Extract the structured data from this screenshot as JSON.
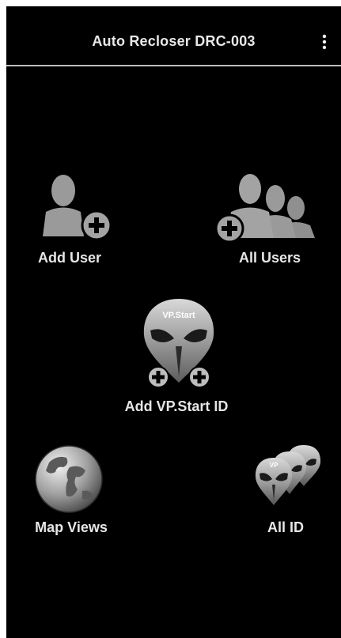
{
  "appbar": {
    "title": "Auto Recloser DRC-003",
    "menu_icon": "overflow-menu-icon"
  },
  "tiles": {
    "add_user": {
      "label": "Add User",
      "icon": "add-user-icon"
    },
    "all_users": {
      "label": "All Users",
      "icon": "users-group-icon"
    },
    "add_vpstart": {
      "label": "Add VP.Start ID",
      "icon": "alien-mask-add-icon",
      "badge_text": "VP.Start"
    },
    "map_views": {
      "label": "Map Views",
      "icon": "globe-icon"
    },
    "all_id": {
      "label": "All ID",
      "icon": "alien-mask-stack-icon",
      "badge_text": "VP"
    }
  },
  "colors": {
    "background": "#000000",
    "text": "#e6e6e6",
    "icon_gray": "#9a9a9a",
    "divider": "#bdbdbd"
  }
}
